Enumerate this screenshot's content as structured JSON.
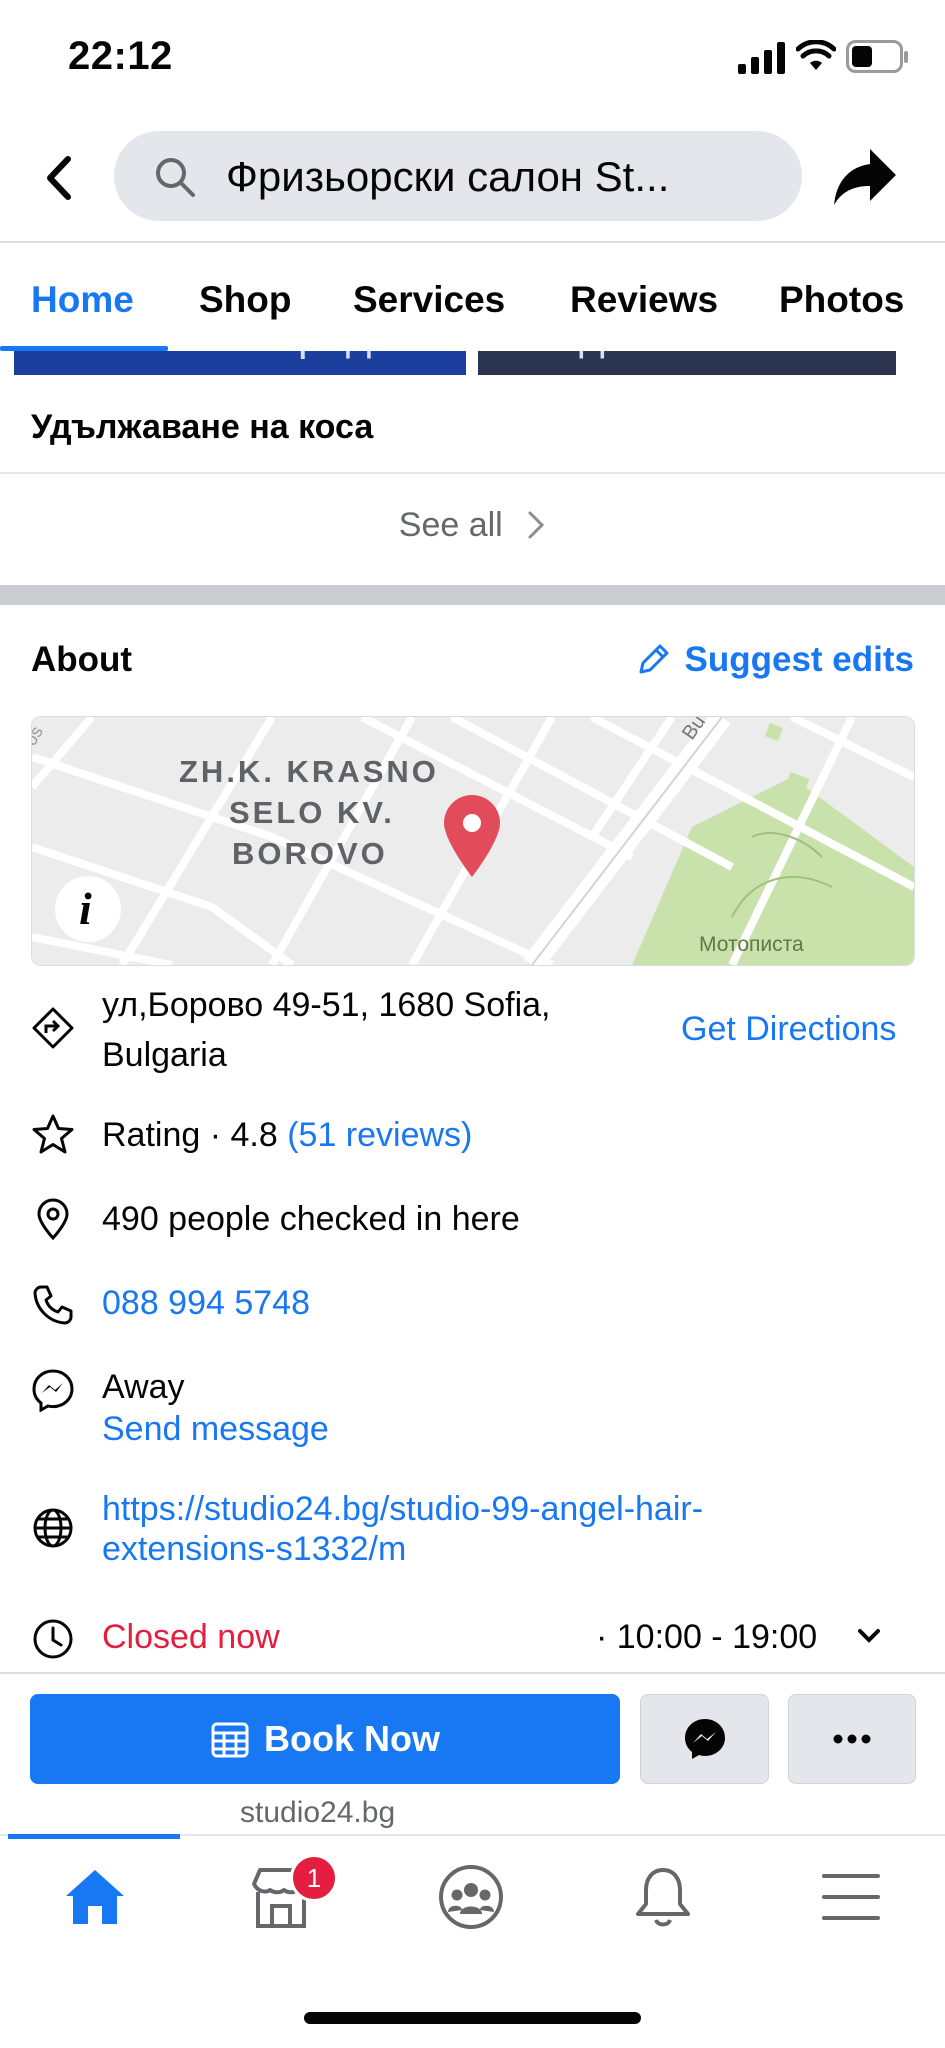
{
  "status_bar": {
    "time": "22:12"
  },
  "search": {
    "query": "Фризьорски салон St..."
  },
  "tabs": [
    {
      "label": "Home"
    },
    {
      "label": "Shop"
    },
    {
      "label": "Services"
    },
    {
      "label": "Reviews"
    },
    {
      "label": "Photos"
    }
  ],
  "thumbs": {
    "left_caption": "преди",
    "right_caption": "след"
  },
  "service": {
    "title": "Удължаване на коса",
    "see_all": "See all"
  },
  "about": {
    "title": "About",
    "suggest_edits": "Suggest edits",
    "map": {
      "district_line1": "ZH.K. KRASNO",
      "district_line2": "SELO KV.",
      "district_line3": "BOROVO",
      "park_label": "Мотописта",
      "street_label": "Bu",
      "street_label_left": "os"
    },
    "address_line1": "ул,Борово 49-51, 1680 Sofia,",
    "address_line2": "Bulgaria",
    "get_directions": "Get Directions",
    "rating_prefix": "Rating · 4.8",
    "rating_reviews": "(51 reviews)",
    "checkins": "490 people checked in here",
    "phone": "088 994 5748",
    "messenger_status": "Away",
    "send_message": "Send message",
    "website_line1": "https://studio24.bg/studio-99-angel-hair-",
    "website_line2": "extensions-s1332/m",
    "hours_status": "Closed now",
    "hours_range": "· 10:00 - 19:00"
  },
  "actions": {
    "book_now": "Book Now",
    "website_small": "studio24.bg"
  },
  "bottom_nav": {
    "notification_count": "1"
  },
  "colors": {
    "accent": "#1877f2",
    "closed": "#e41e3f",
    "text": "#050505",
    "secondary": "#65676b"
  }
}
